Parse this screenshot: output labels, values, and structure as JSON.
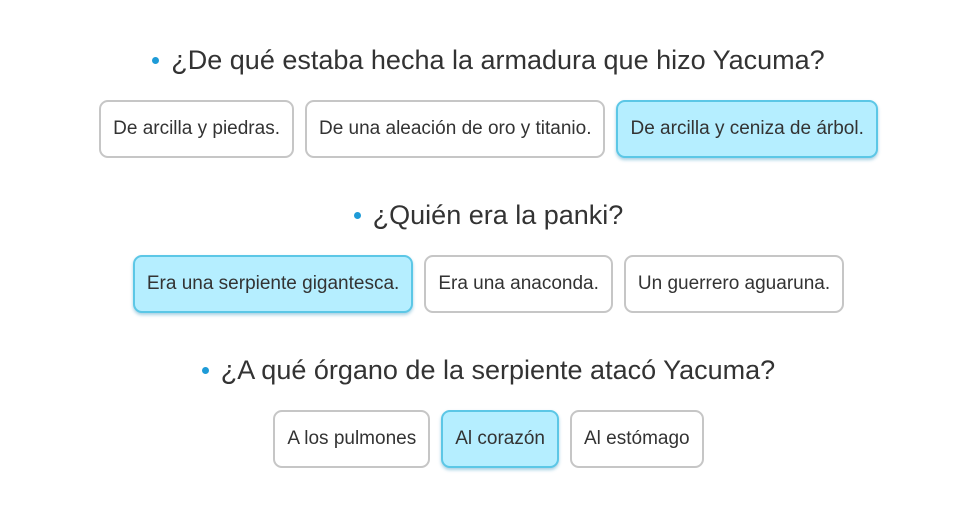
{
  "questions": [
    {
      "text": "¿De qué estaba hecha la armadura que hizo Yacuma?",
      "options": [
        {
          "label": "De arcilla y piedras.",
          "selected": false
        },
        {
          "label": "De una aleación de oro y titanio.",
          "selected": false
        },
        {
          "label": "De arcilla y ceniza de árbol.",
          "selected": true
        }
      ]
    },
    {
      "text": "¿Quién era la panki?",
      "options": [
        {
          "label": "Era una serpiente gigantesca.",
          "selected": true
        },
        {
          "label": "Era una anaconda.",
          "selected": false
        },
        {
          "label": "Un guerrero aguaruna.",
          "selected": false
        }
      ]
    },
    {
      "text": "¿A qué órgano de la serpiente atacó Yacuma?",
      "options": [
        {
          "label": "A los pulmones",
          "selected": false
        },
        {
          "label": "Al corazón",
          "selected": true
        },
        {
          "label": "Al estómago",
          "selected": false
        }
      ]
    }
  ],
  "colors": {
    "bullet": "#1e9bd7",
    "selected_background": "#b5eeff",
    "selected_border": "#5cc7e6",
    "unselected_border": "#c6c6c6"
  }
}
